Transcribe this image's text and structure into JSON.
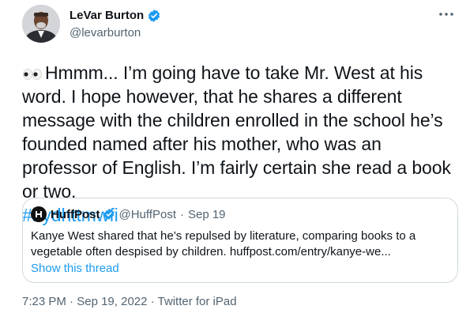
{
  "author": {
    "name": "LeVar Burton",
    "handle": "@levarburton",
    "verified_color": "#1d9bf0"
  },
  "tweet": {
    "emoji": "eyes",
    "text": "Hmmm...  I’m going have to take Mr. West at his word. I hope however, that he shares a different message with the children enrolled in the school he’s founded named after his mother, who was an professor of English. I’m fairly certain she read a book or two.",
    "hashtag": "#bydhttmwfi",
    "hashtag_color": "#1d9bf0"
  },
  "quote": {
    "name": "HuffPost",
    "handle": "@HuffPost",
    "separator": "·",
    "date": "Sep 19",
    "text": "Kanye West shared that he’s repulsed by literature, comparing books to a vegetable often despised by children. huffpost.com/entry/kanye-we...",
    "show_thread": "Show this thread"
  },
  "meta": {
    "time": "7:23 PM",
    "date": "Sep 19, 2022",
    "source": "Twitter for iPad",
    "separator": "·"
  }
}
